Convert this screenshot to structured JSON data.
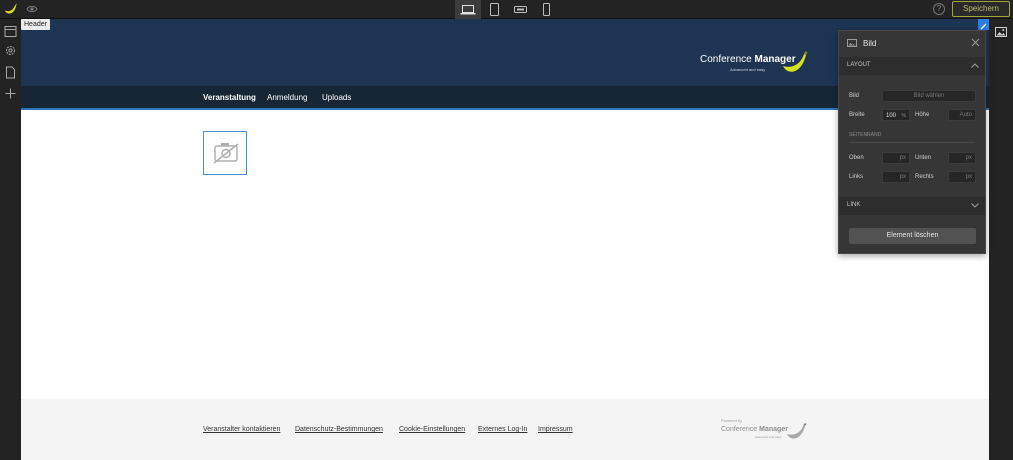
{
  "toolbar": {
    "save_label": "Speichern",
    "help_label": "?",
    "devices": [
      "desktop",
      "tablet-portrait",
      "tablet-landscape",
      "mobile"
    ],
    "active_device": "desktop"
  },
  "left_sidebar": {
    "tooltip": "Header",
    "icons": [
      "layout-icon",
      "settings-icon",
      "page-icon",
      "add-icon"
    ]
  },
  "site": {
    "brand_light": "Conference",
    "brand_bold": "Manager",
    "brand_tagline": "Advanced and easy",
    "nav": [
      "Veranstaltung",
      "Anmeldung",
      "Uploads"
    ],
    "footer_links": [
      "Veranstalter kontaktieren",
      "Datenschutz-Bestimmungen",
      "Cookie-Einstellungen",
      "Externes Log-In",
      "Impressum"
    ],
    "footer_powered": "Powered by",
    "footer_brand_light": "Conference",
    "footer_brand_bold": "Manager",
    "footer_tagline": "Advanced and easy"
  },
  "panel": {
    "title": "Bild",
    "section_layout": "LAYOUT",
    "bild_label": "Bild",
    "bild_button": "Bild wählen",
    "breite_label": "Breite",
    "breite_value": "100",
    "breite_unit": "%",
    "hoehe_label": "Höhe",
    "hoehe_value": "Auto",
    "seitenrand_label": "SEITENRAND",
    "oben_label": "Oben",
    "unten_label": "Unten",
    "links_label": "Links",
    "rechts_label": "Rechts",
    "px": "px",
    "section_link": "LINK",
    "delete_label": "Element löschen"
  },
  "colors": {
    "header_bg": "#1d3552",
    "nav_bg": "#172636",
    "accent_blue": "#2f74b5",
    "banana_yellow": "#d7df23",
    "save_border": "#9fa538",
    "panel_bg": "#363636"
  }
}
